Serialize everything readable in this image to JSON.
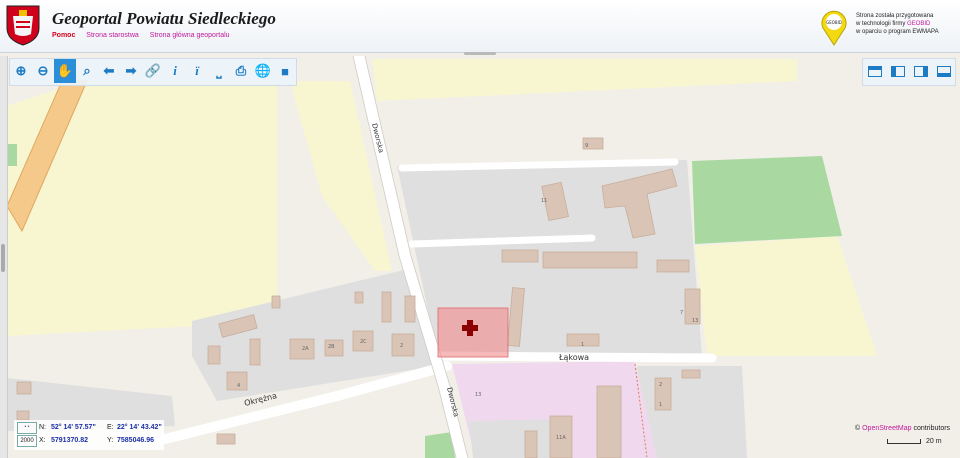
{
  "header": {
    "title": "Geoportal Powiatu Siedleckiego",
    "links": [
      "Pomoc",
      "Strona starostwa",
      "Strona główna geoportalu"
    ],
    "logo_text": "GEOBID",
    "credit_lines": [
      "Strona została przygotowana",
      "w technologii firmy ",
      "w oparciu o program EWMAPA"
    ],
    "credit_brand": "GEOBID"
  },
  "toolbar": {
    "tools": [
      "zoom-in",
      "zoom-out",
      "pan",
      "zoom-box",
      "previous-view",
      "next-view",
      "link",
      "info",
      "info-text",
      "measure",
      "print",
      "globe",
      "camera"
    ],
    "active_tool": "pan",
    "right_tools": [
      "layout-top",
      "layout-left",
      "layout-right",
      "fullscreen"
    ]
  },
  "map": {
    "streets": {
      "dworska_north": "Dworska",
      "dworska_south": "Dworska",
      "lakowa": "Łąkowa",
      "okrezna": "Okrężna"
    },
    "house_numbers": [
      "9",
      "11",
      "7",
      "13",
      "1",
      "2A",
      "2B",
      "2C",
      "2",
      "4",
      "13",
      "11A",
      "2",
      "1"
    ],
    "marker": "pharmacy-cross",
    "attribution_prefix": "© ",
    "attribution_link": "OpenStreetMap",
    "attribution_suffix": " contributors",
    "scale_label": "20 m",
    "colors": {
      "background": "#f2efe9",
      "residential": "#e0dfdf",
      "building": "#d9c4b6",
      "farmland": "#f7f6d0",
      "grass": "#a9d8a0",
      "selection": "#f08a8a",
      "marker": "#8b0000"
    }
  },
  "coords": {
    "crs": "2000",
    "n_label": "N:",
    "n_value": "52° 14' 57.57\"",
    "e_label": "E:",
    "e_value": "22° 14' 43.42\"",
    "x_label": "X:",
    "x_value": "5791370.82",
    "y_label": "Y:",
    "y_value": "7585046.96"
  }
}
